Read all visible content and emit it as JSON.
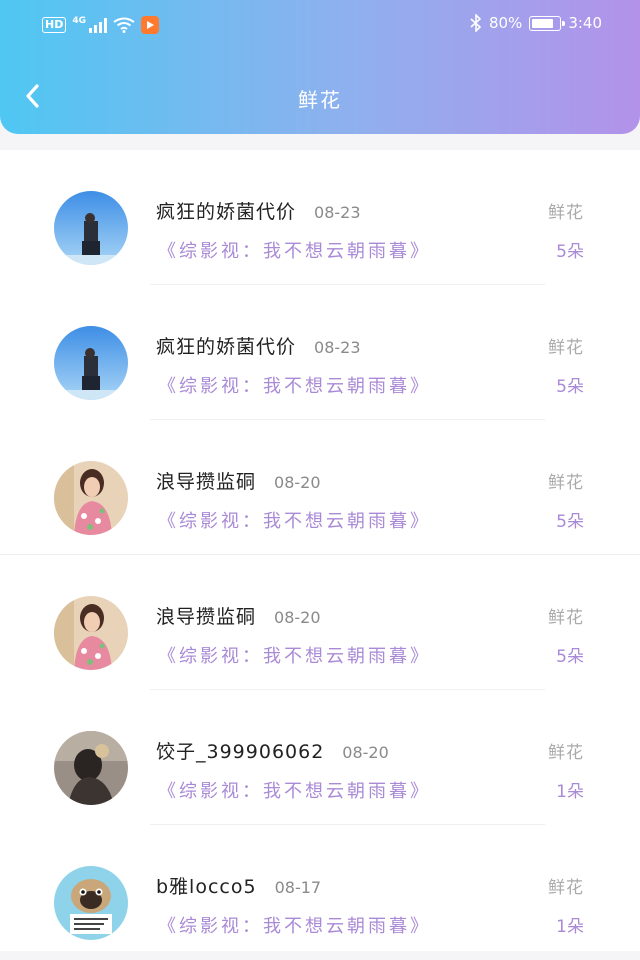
{
  "status_bar": {
    "hd": "HD",
    "network": "4G",
    "battery_pct": "80%",
    "battery_level": 0.8,
    "time": "3:40"
  },
  "header": {
    "title": "鲜花",
    "back_icon": "chevron-left-icon"
  },
  "colors": {
    "header_gradient": [
      "#4fc7f2",
      "#b392ea"
    ],
    "accent": "#a98ad6"
  },
  "records": [
    {
      "user": "疯狂的娇菌代价",
      "date": "08-23",
      "work": "《综影视：我不想云朝雨暮》",
      "gift": "鲜花",
      "count": "5朵",
      "avatar": "sky-photo"
    },
    {
      "user": "疯狂的娇菌代价",
      "date": "08-23",
      "work": "《综影视：我不想云朝雨暮》",
      "gift": "鲜花",
      "count": "5朵",
      "avatar": "sky-photo"
    },
    {
      "user": "浪导攒监硐",
      "date": "08-20",
      "work": "《综影视：我不想云朝雨暮》",
      "gift": "鲜花",
      "count": "5朵",
      "avatar": "girl-photo"
    },
    {
      "user": "浪导攒监硐",
      "date": "08-20",
      "work": "《综影视：我不想云朝雨暮》",
      "gift": "鲜花",
      "count": "5朵",
      "avatar": "girl-photo"
    },
    {
      "user": "饺子_399906062",
      "date": "08-20",
      "work": "《综影视：我不想云朝雨暮》",
      "gift": "鲜花",
      "count": "1朵",
      "avatar": "dark-photo"
    },
    {
      "user": "b雅locco5",
      "date": "08-17",
      "work": "《综影视：我不想云朝雨暮》",
      "gift": "鲜花",
      "count": "1朵",
      "avatar": "pug-photo"
    }
  ]
}
